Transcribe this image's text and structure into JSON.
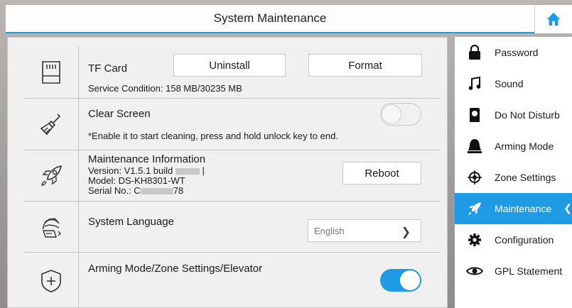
{
  "header": {
    "title": "System Maintenance",
    "home_icon": "home-icon"
  },
  "rows": {
    "tf_card": {
      "title": "TF Card",
      "uninstall_label": "Uninstall",
      "format_label": "Format",
      "status": "Service Condition: 158 MB/30235 MB",
      "icon": "sd-card-icon"
    },
    "clear_screen": {
      "title": "Clear Screen",
      "note": "*Enable it to start cleaning, press and hold unlock key to end.",
      "toggle_state": "off",
      "icon": "broom-icon"
    },
    "maintenance": {
      "title": "Maintenance Information",
      "version_prefix": "Version: V1.5.1 build ",
      "model": "Model: DS-KH8301-WT",
      "serial_prefix": "Serial No.: C",
      "serial_suffix": "78",
      "reboot_label": "Reboot",
      "icon": "rocket-icon"
    },
    "language": {
      "title": "System Language",
      "value": "English",
      "icon": "globe-icon"
    },
    "arming": {
      "title": "Arming Mode/Zone Settings/Elevator",
      "toggle_state": "on",
      "icon": "shield-plus-icon"
    }
  },
  "sidebar": {
    "items": [
      {
        "label": "Password",
        "icon": "lock-icon"
      },
      {
        "label": "Sound",
        "icon": "music-note-icon"
      },
      {
        "label": "Do Not Disturb",
        "icon": "moon-icon"
      },
      {
        "label": "Arming Mode",
        "icon": "bell-icon"
      },
      {
        "label": "Zone Settings",
        "icon": "crosshair-icon"
      },
      {
        "label": "Maintenance",
        "icon": "rocket-icon",
        "active": true
      },
      {
        "label": "Configuration",
        "icon": "gear-icon"
      },
      {
        "label": "GPL Statement",
        "icon": "eye-icon"
      }
    ]
  },
  "colors": {
    "accent": "#1f9be3",
    "panel": "#f0f0f0"
  }
}
